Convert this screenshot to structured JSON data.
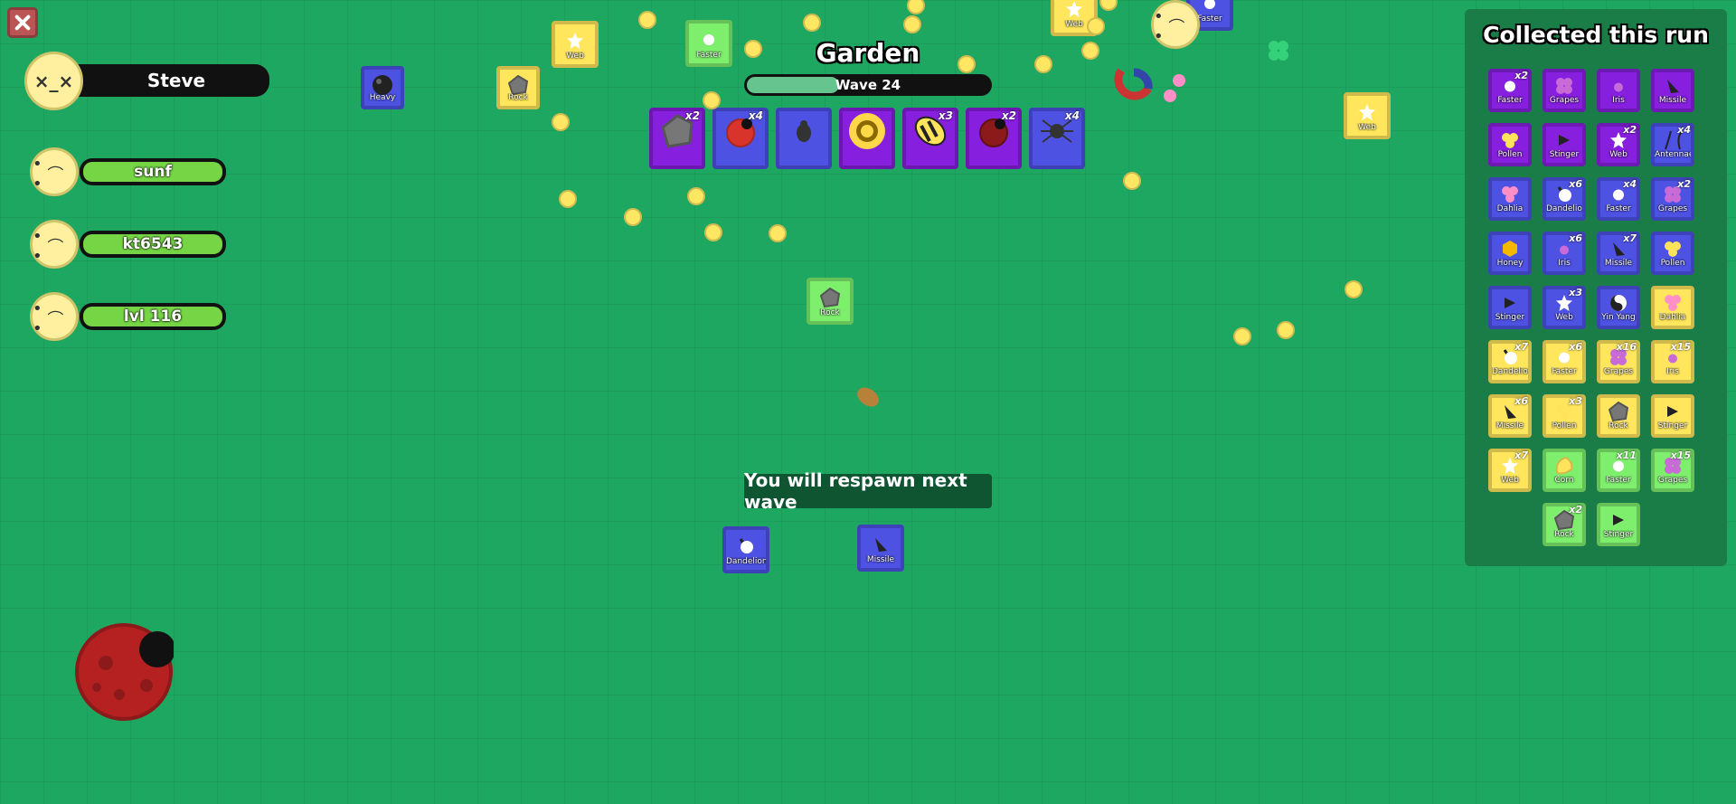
{
  "hud": {
    "player_name": "Steve",
    "squad": [
      {
        "name": "sunf"
      },
      {
        "name": "kt6543"
      },
      {
        "name": "lvl 116"
      }
    ]
  },
  "biome": {
    "title": "Garden",
    "wave_label": "Wave 24",
    "wave_progress": 0.38
  },
  "mob_slots": [
    {
      "mob": "rock",
      "rarity": "epic",
      "count": "x2"
    },
    {
      "mob": "ladybug",
      "rarity": "rare",
      "count": "x4"
    },
    {
      "mob": "beetle",
      "rarity": "rare",
      "count": ""
    },
    {
      "mob": "sunflower",
      "rarity": "epic",
      "count": ""
    },
    {
      "mob": "bee",
      "rarity": "epic",
      "count": "x3"
    },
    {
      "mob": "dark-ladybug",
      "rarity": "epic",
      "count": "x2"
    },
    {
      "mob": "spider",
      "rarity": "rare",
      "count": "x4"
    }
  ],
  "field_drops": [
    {
      "label": "Heavy",
      "rarity": "rare",
      "icon": "heavy-icon"
    },
    {
      "label": "Rock",
      "rarity": "unusual",
      "icon": "rock-icon"
    },
    {
      "label": "Web",
      "rarity": "unusual",
      "icon": "web-icon"
    },
    {
      "label": "Faster",
      "rarity": "common",
      "icon": "faster-icon"
    },
    {
      "label": "Web",
      "rarity": "unusual",
      "icon": "web-icon"
    },
    {
      "label": "Faster",
      "rarity": "rare",
      "icon": "faster-icon"
    },
    {
      "label": "Web",
      "rarity": "unusual",
      "icon": "web-icon"
    },
    {
      "label": "Rock",
      "rarity": "common",
      "icon": "rock-icon"
    },
    {
      "label": "Dandelion",
      "rarity": "rare",
      "icon": "dandelion-icon"
    },
    {
      "label": "Missile",
      "rarity": "rare",
      "icon": "missile-icon"
    }
  ],
  "respawn_message": "You will respawn next wave",
  "collected": {
    "title": "Collected this run",
    "items": [
      {
        "label": "Faster",
        "rarity": "epic",
        "count": "x2",
        "icon": "faster-icon"
      },
      {
        "label": "Grapes",
        "rarity": "epic",
        "count": "",
        "icon": "grapes-icon"
      },
      {
        "label": "Iris",
        "rarity": "epic",
        "count": "",
        "icon": "iris-icon"
      },
      {
        "label": "Missile",
        "rarity": "epic",
        "count": "",
        "icon": "missile-icon"
      },
      {
        "label": "Pollen",
        "rarity": "epic",
        "count": "",
        "icon": "pollen-icon"
      },
      {
        "label": "Stinger",
        "rarity": "epic",
        "count": "",
        "icon": "stinger-icon"
      },
      {
        "label": "Web",
        "rarity": "epic",
        "count": "x2",
        "icon": "web-icon"
      },
      {
        "label": "Antennae",
        "rarity": "rare",
        "count": "x4",
        "icon": "antennae-icon"
      },
      {
        "label": "Dahlia",
        "rarity": "rare",
        "count": "",
        "icon": "dahlia-icon"
      },
      {
        "label": "Dandelion",
        "rarity": "rare",
        "count": "x6",
        "icon": "dandelion-icon"
      },
      {
        "label": "Faster",
        "rarity": "rare",
        "count": "x4",
        "icon": "faster-icon"
      },
      {
        "label": "Grapes",
        "rarity": "rare",
        "count": "x2",
        "icon": "grapes-icon"
      },
      {
        "label": "Honey",
        "rarity": "rare",
        "count": "",
        "icon": "honey-icon"
      },
      {
        "label": "Iris",
        "rarity": "rare",
        "count": "x6",
        "icon": "iris-icon"
      },
      {
        "label": "Missile",
        "rarity": "rare",
        "count": "x7",
        "icon": "missile-icon"
      },
      {
        "label": "Pollen",
        "rarity": "rare",
        "count": "",
        "icon": "pollen-icon"
      },
      {
        "label": "Stinger",
        "rarity": "rare",
        "count": "",
        "icon": "stinger-icon"
      },
      {
        "label": "Web",
        "rarity": "rare",
        "count": "x3",
        "icon": "web-icon"
      },
      {
        "label": "Yin Yang",
        "rarity": "rare",
        "count": "",
        "icon": "yinyang-icon"
      },
      {
        "label": "Dahlia",
        "rarity": "unusual",
        "count": "",
        "icon": "dahlia-icon"
      },
      {
        "label": "Dandelion",
        "rarity": "unusual",
        "count": "x7",
        "icon": "dandelion-icon"
      },
      {
        "label": "Faster",
        "rarity": "unusual",
        "count": "x6",
        "icon": "faster-icon"
      },
      {
        "label": "Grapes",
        "rarity": "unusual",
        "count": "x16",
        "icon": "grapes-icon"
      },
      {
        "label": "Iris",
        "rarity": "unusual",
        "count": "x15",
        "icon": "iris-icon"
      },
      {
        "label": "Missile",
        "rarity": "unusual",
        "count": "x6",
        "icon": "missile-icon"
      },
      {
        "label": "Pollen",
        "rarity": "unusual",
        "count": "x3",
        "icon": "pollen-icon"
      },
      {
        "label": "Rock",
        "rarity": "unusual",
        "count": "",
        "icon": "rock-icon"
      },
      {
        "label": "Stinger",
        "rarity": "unusual",
        "count": "",
        "icon": "stinger-icon"
      },
      {
        "label": "Web",
        "rarity": "unusual",
        "count": "x7",
        "icon": "web-icon"
      },
      {
        "label": "Corn",
        "rarity": "common",
        "count": "",
        "icon": "corn-icon"
      },
      {
        "label": "Faster",
        "rarity": "common",
        "count": "x11",
        "icon": "faster-icon"
      },
      {
        "label": "Grapes",
        "rarity": "common",
        "count": "x15",
        "icon": "grapes-icon"
      },
      {
        "label": "Rock",
        "rarity": "common",
        "count": "x2",
        "icon": "rock-icon"
      },
      {
        "label": "Stinger",
        "rarity": "common",
        "count": "",
        "icon": "stinger-icon"
      }
    ]
  },
  "colors": {
    "background": "#1ea761",
    "common": "#7eef6d",
    "unusual": "#ffe65d",
    "rare": "#4d52e3",
    "epic": "#861fde",
    "coin": "#ffe763",
    "health": "#75d545"
  }
}
